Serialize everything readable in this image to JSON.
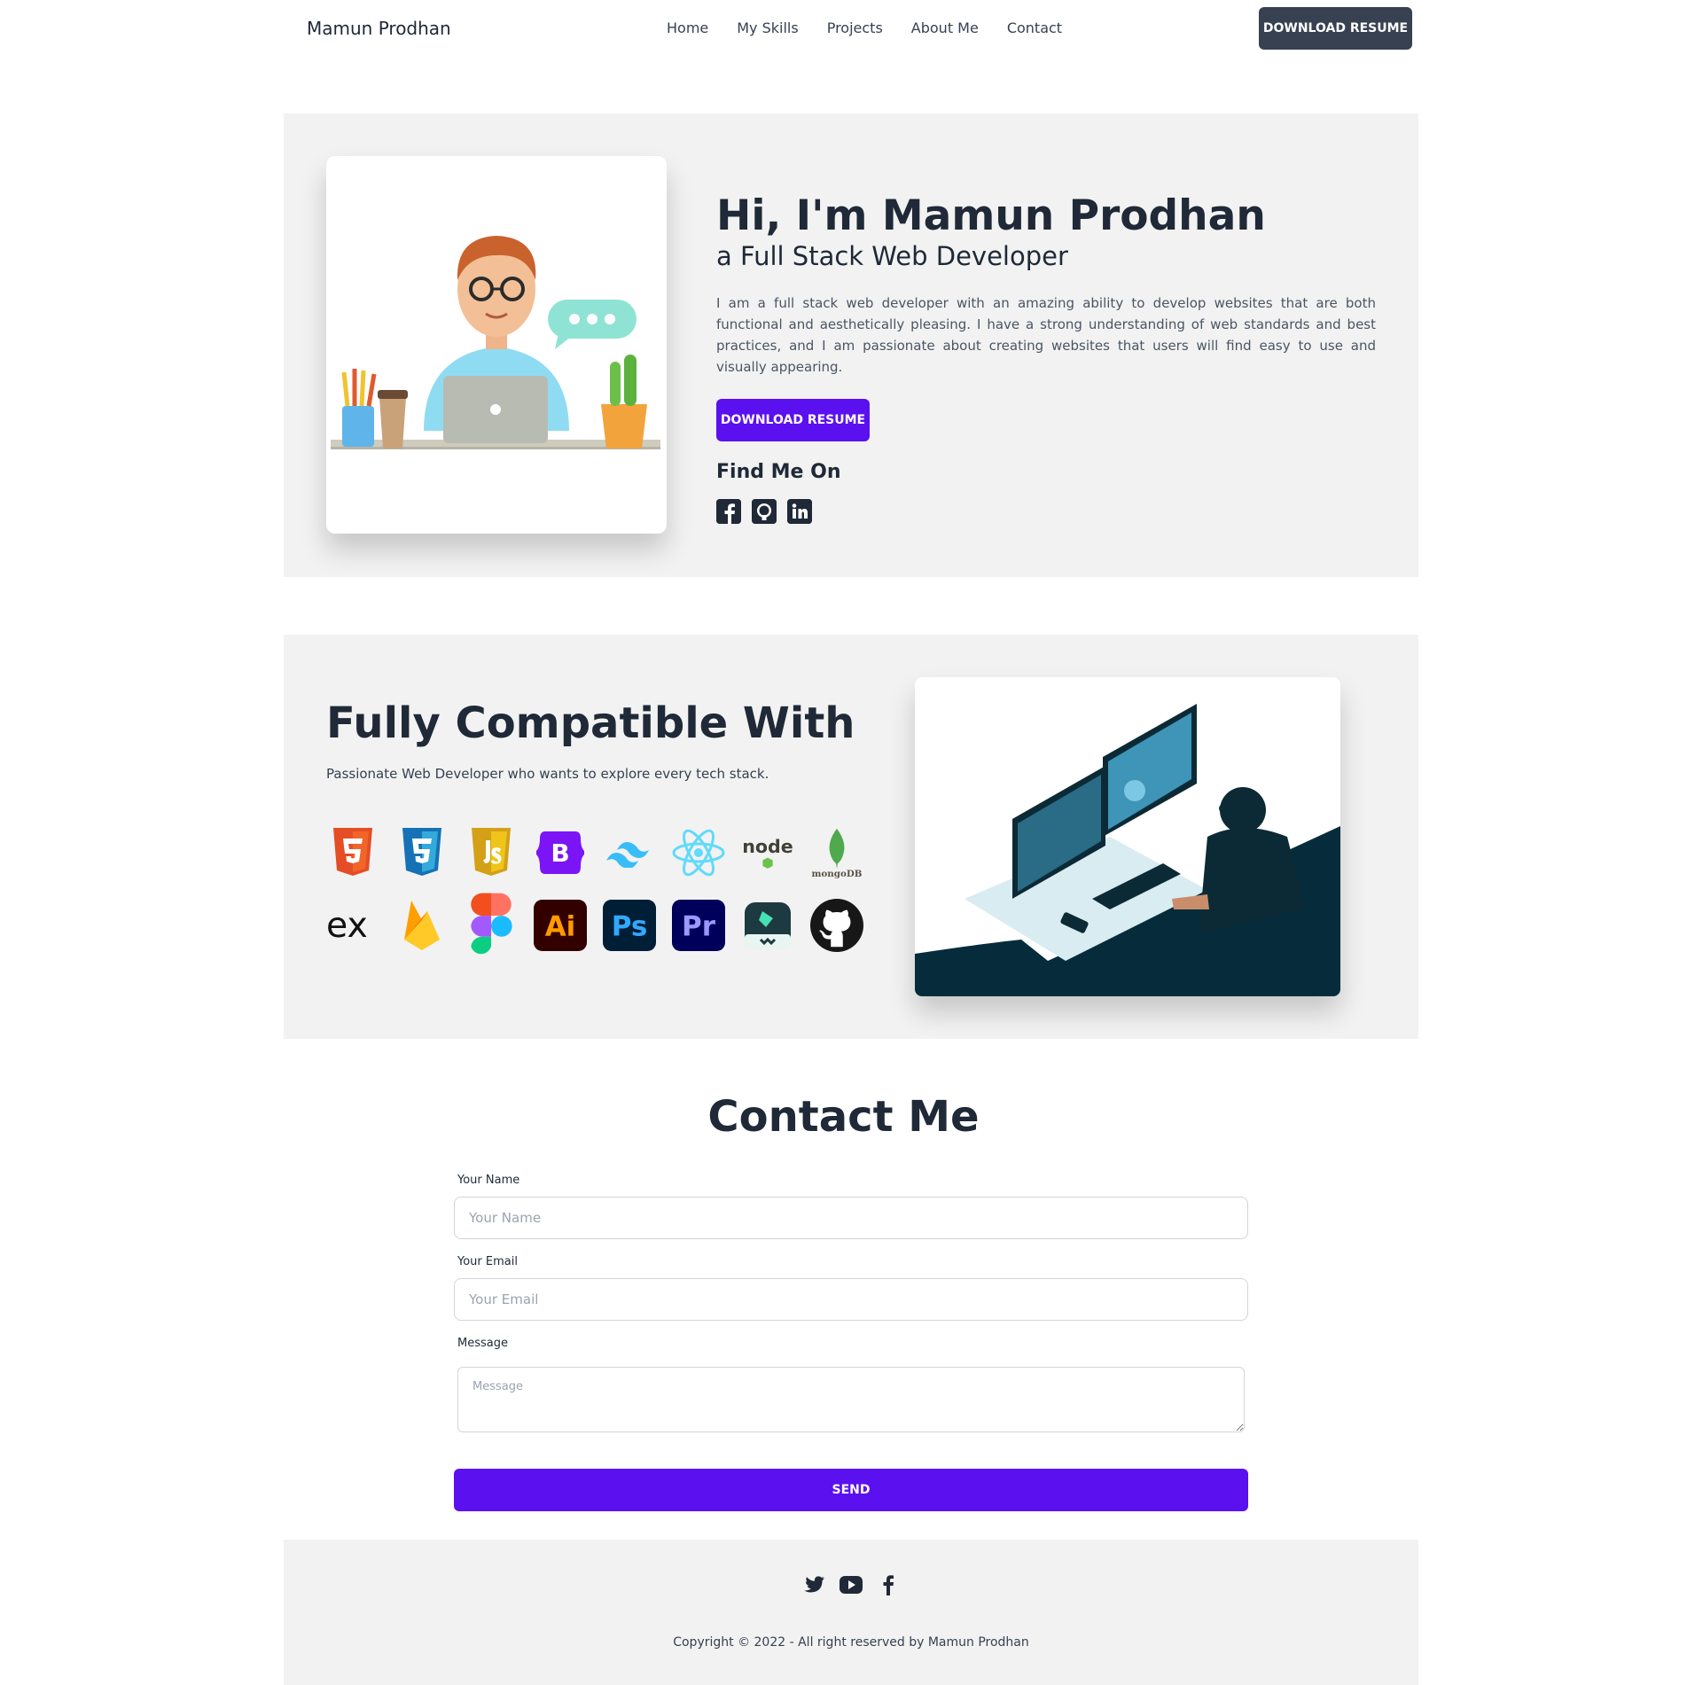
{
  "nav": {
    "brand": "Mamun Prodhan",
    "links": [
      "Home",
      "My Skills",
      "Projects",
      "About Me",
      "Contact"
    ],
    "button": "DOWNLOAD RESUME"
  },
  "hero": {
    "title": "Hi, I'm Mamun Prodhan",
    "subtitle": "a Full Stack Web Developer",
    "description": "I am a full stack web developer with an amazing ability to develop websites that are both functional and aesthetically pleasing. I have a strong understanding of web standards and best practices, and I am passionate about creating websites that users will find easy to use and visually appearing.",
    "button": "DOWNLOAD RESUME",
    "find_title": "Find Me On",
    "social_icons": [
      "facebook-icon",
      "github-icon",
      "linkedin-icon"
    ]
  },
  "skills": {
    "title": "Fully Compatible With",
    "subtitle": "Passionate Web Developer who wants to explore every tech stack.",
    "icons": [
      "html5-icon",
      "css3-icon",
      "javascript-icon",
      "bootstrap-icon",
      "tailwind-icon",
      "react-icon",
      "nodejs-icon",
      "mongodb-icon",
      "express-icon",
      "firebase-icon",
      "figma-icon",
      "illustrator-icon",
      "photoshop-icon",
      "premiere-icon",
      "filmora-icon",
      "github-icon"
    ],
    "icon_text": {
      "bootstrap": "B",
      "node": "node",
      "mongodb": "mongoDB",
      "express": "ex",
      "illustrator": "Ai",
      "photoshop": "Ps",
      "premiere": "Pr"
    }
  },
  "contact": {
    "title": "Contact Me",
    "name_label": "Your Name",
    "name_placeholder": "Your Name",
    "email_label": "Your Email",
    "email_placeholder": "Your Email",
    "message_label": "Message",
    "message_placeholder": "Message",
    "send": "SEND"
  },
  "footer": {
    "icons": [
      "twitter-icon",
      "youtube-icon",
      "facebook-icon"
    ],
    "copyright": "Copyright © 2022 - All right reserved by Mamun Prodhan"
  },
  "colors": {
    "accent": "#5b10f0",
    "dark": "#374151",
    "section_bg": "#f2f2f2"
  }
}
